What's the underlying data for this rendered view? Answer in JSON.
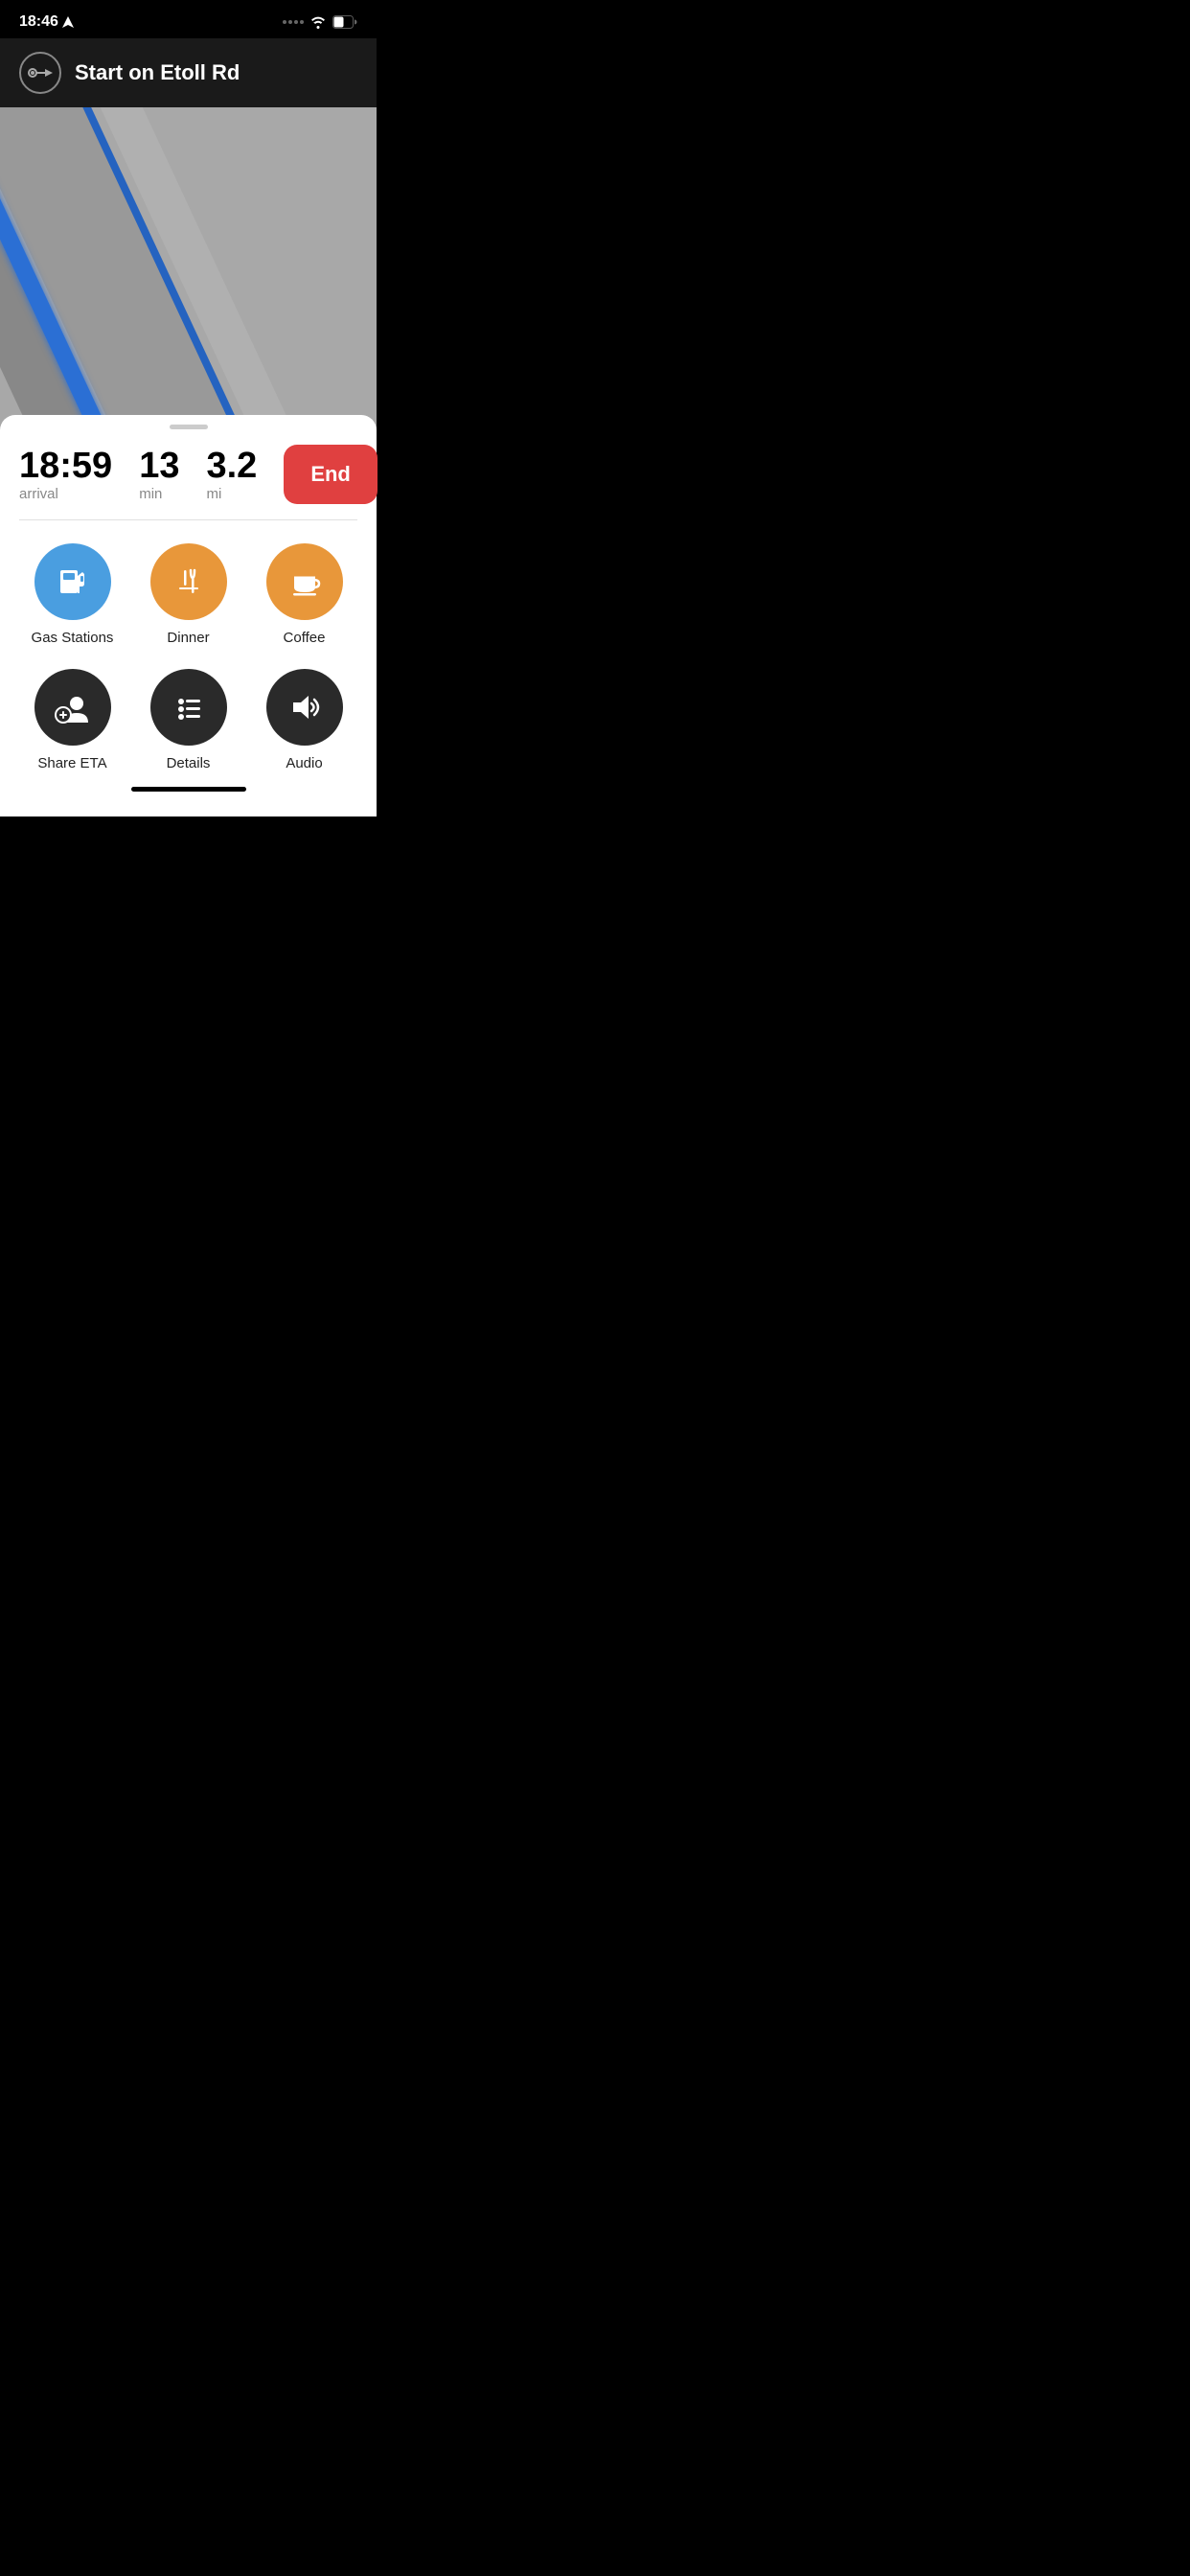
{
  "statusBar": {
    "time": "18:46",
    "locationIcon": true
  },
  "navHeader": {
    "instruction": "Start on Etoll Rd"
  },
  "tripInfo": {
    "arrival": "18:59",
    "arrivalLabel": "arrival",
    "duration": "13",
    "durationLabel": "min",
    "distance": "3.2",
    "distanceLabel": "mi",
    "endButton": "End"
  },
  "actions": [
    {
      "id": "gas-stations",
      "label": "Gas Stations",
      "color": "blue",
      "icon": "gas"
    },
    {
      "id": "dinner",
      "label": "Dinner",
      "color": "orange",
      "icon": "dinner"
    },
    {
      "id": "coffee",
      "label": "Coffee",
      "color": "orange",
      "icon": "coffee"
    },
    {
      "id": "share-eta",
      "label": "Share ETA",
      "color": "dark",
      "icon": "share-eta"
    },
    {
      "id": "details",
      "label": "Details",
      "color": "dark",
      "icon": "details"
    },
    {
      "id": "audio",
      "label": "Audio",
      "color": "dark",
      "icon": "audio"
    }
  ]
}
